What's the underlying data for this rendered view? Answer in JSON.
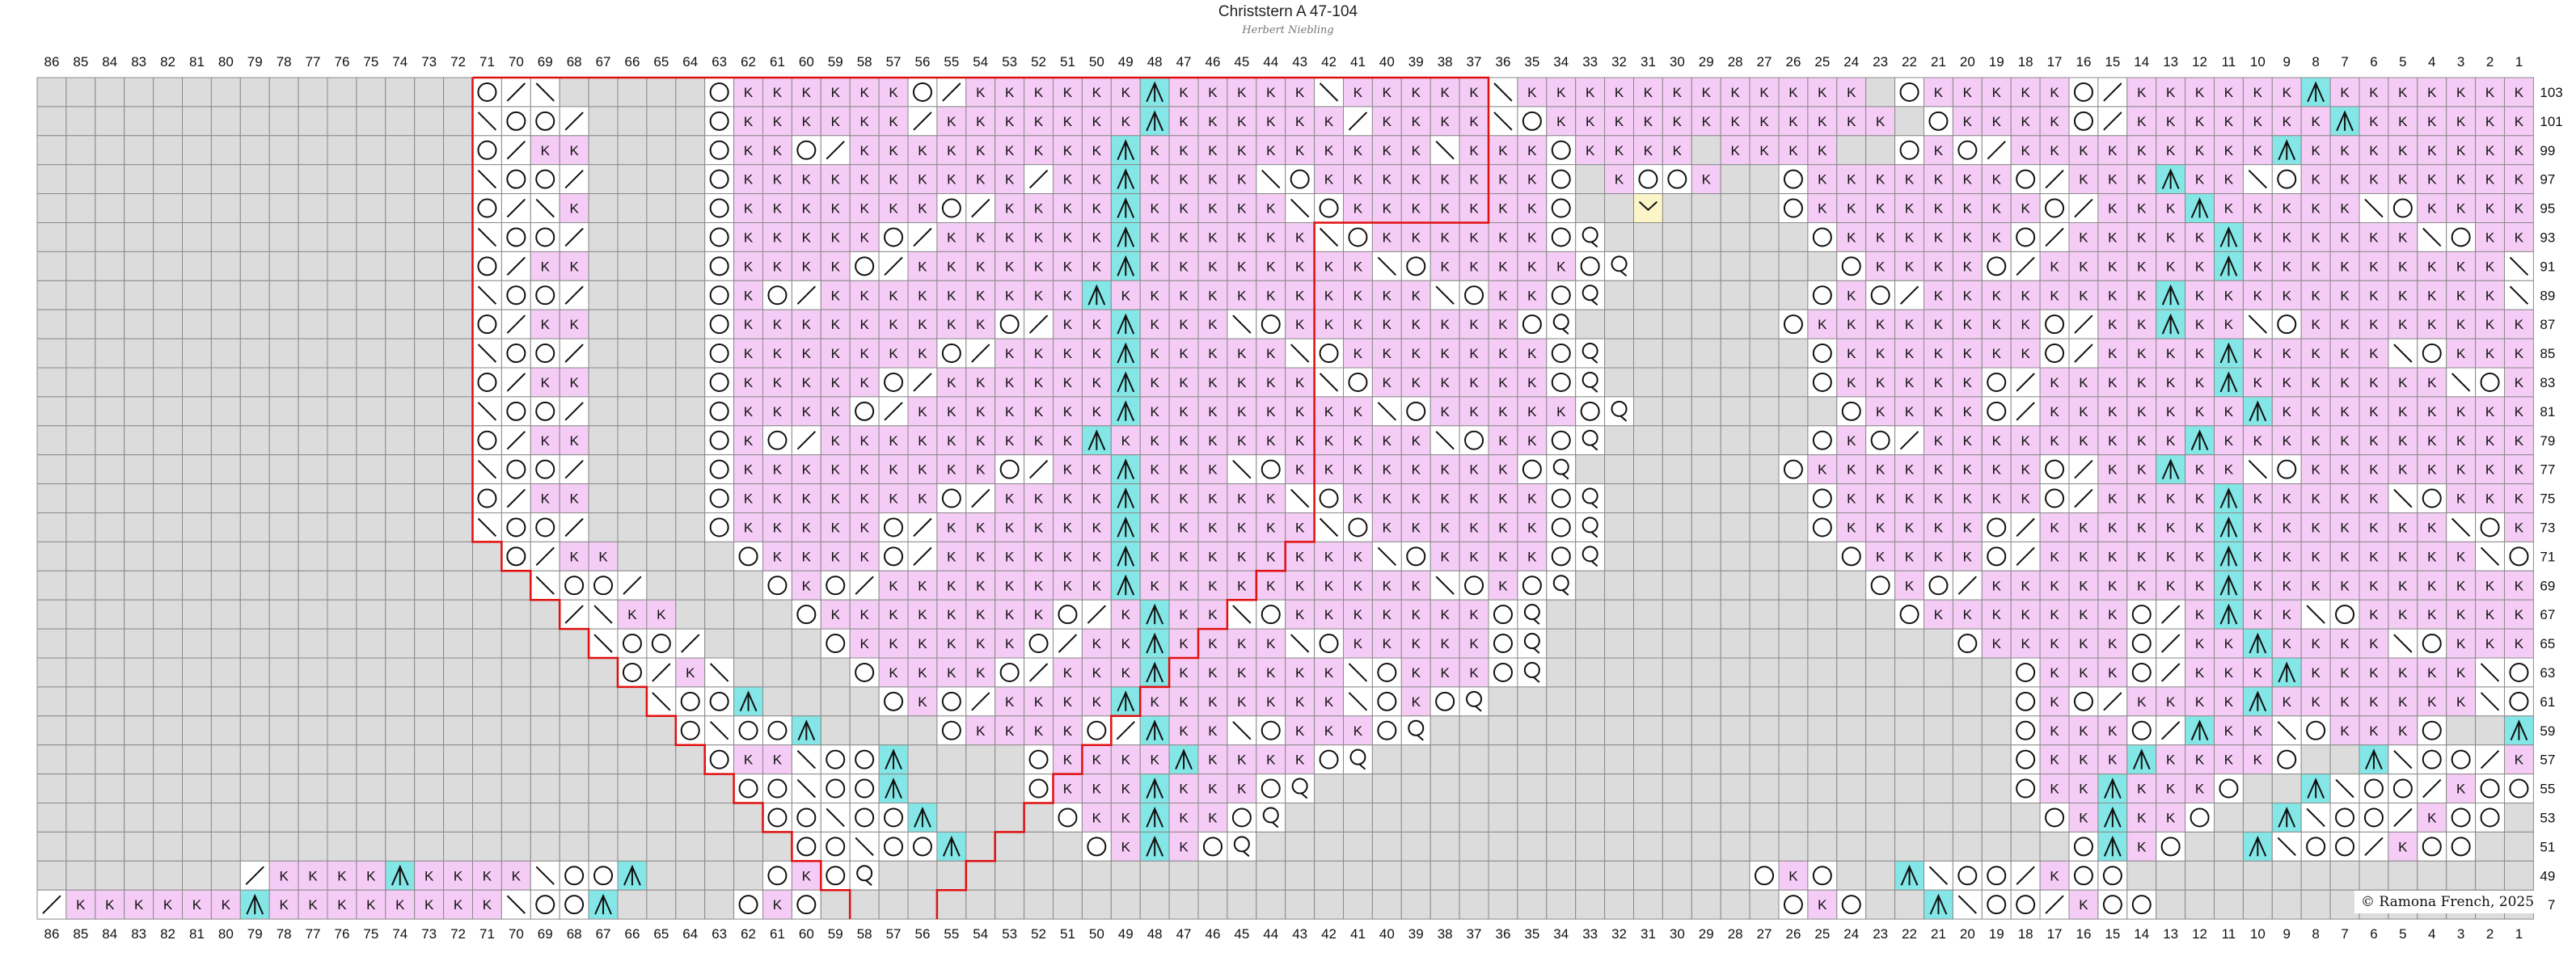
{
  "title": "Christstern A 47-104",
  "subtitle": "Herbert Niebling",
  "copyright": "©  Ramona French, 2025",
  "colors": {
    "background_cell": "#dcdcdc",
    "knit_cell": "#f5ccf5",
    "plain_cell": "#ffffff",
    "decrease_cell": "#84e6e6",
    "special_cell": "#fbf5c8",
    "outline": "#e01010",
    "grid_line": "#8a8a8a"
  },
  "column_numbers": [
    86,
    85,
    84,
    83,
    82,
    81,
    80,
    79,
    78,
    77,
    76,
    75,
    74,
    73,
    72,
    71,
    70,
    69,
    68,
    67,
    66,
    65,
    64,
    63,
    62,
    61,
    60,
    59,
    58,
    57,
    56,
    55,
    54,
    53,
    52,
    51,
    50,
    49,
    48,
    47,
    46,
    45,
    44,
    43,
    42,
    41,
    40,
    39,
    38,
    37,
    36,
    35,
    34,
    33,
    32,
    31,
    30,
    29,
    28,
    27,
    26,
    25,
    24,
    23,
    22,
    21,
    20,
    19,
    18,
    17,
    16,
    15,
    14,
    13,
    12,
    11,
    10,
    9,
    8,
    7,
    6,
    5,
    4,
    3,
    2,
    1
  ],
  "row_numbers": [
    103,
    101,
    99,
    97,
    95,
    93,
    91,
    89,
    87,
    85,
    83,
    81,
    79,
    77,
    75,
    73,
    71,
    69,
    67,
    65,
    63,
    61,
    59,
    57,
    55,
    53,
    51,
    49,
    47
  ],
  "legend": {
    "K": "knit (K)",
    "O": "yarn over",
    "/": "k2tog",
    "\\": "ssk",
    "A": "centered double decrease",
    "Q": "twisted yarn over",
    "V": "special stitch",
    "_": "no stitch",
    ".": "empty"
  },
  "chart_rows": [
    "_______________O/\\_____OKKKKKKO/KKKKKKAKKKKK\\KKKKK\\KKKKKKKKKKKK_OKKKKKO/KKKKKKAKKKKKKKK\\OKKKKO__/\\O_",
    "_______________\\OO/____OKKKKKK/KKKKKKKAKKKKKK/KKKK\\OKKKKKKKKKKKK_OKKKKO/KKKKKKKAKKKKKKKKK\\KKKKO__\\OO/_",
    "_______________O/KK____OKKO/KKKKKKKKKAKKKKKKKKKK\\KKKOKKKK_KKKK__OKO/KKKKKKKKKAKKKKKKKKKK\\OKO__KK\\O_",
    "_______________\\OO/____OKKKKKKKKKK/KKAKKKK\\OKKKKKKKKO_KOOK__OKKKKKKKO/KKKAKK\\OKKKKKKKKKO__\\OO/_",
    "_______________O/\\K____OKKKKKKKO/KKKKAKKKKK\\OKKKKKKKO__V____OKKKKKKKKO/KKKAKKKKK\\OKKKKKKKO__KK\\O_",
    "_______________\\OO/____OKKKKKO/KKKKKKAKKKKKK\\OKKKKKKOQ_______OKKKKKKO/KKKKKAKKKKKK\\OKKKKKKO__\\OO/_",
    "_______________O/KK____OKKKKO/KKKKKKKAKKKKKKKK\\OKKKKKOQ_______OKKKKO/KKKKKKAKKKKKKKKK\\OKKKKO__KK\\O_",
    "_______________\\OO/____OKO/KKKKKKKKKAKKKKKKKKKKK\\OKKOQ_______OKO/KKKKKKKKAKKKKKKKKKKK\\OKO__\\OO/_",
    "_______________O/KK____OKKKKKKKKKO/KKAKKK\\OKKKKKKKKOQ_______OKKKKKKKKO/KKAKK\\OKKKKKKKKKO__KK\\O_",
    "_______________\\OO/____OKKKKKKKO/KKKKAKKKKK\\OKKKKKKKOQ_______OKKKKKKKO/KKKKAKKKKK\\OKKKKKKKO__\\OO/_",
    "_______________O/KK____OKKKKKO/KKKKKKAKKKKKK\\OKKKKKKOQ_______OKKKKKO/KKKKKKAKKKKKKK\\OKKKKKKO__KK\\O_",
    "_______________\\OO/____OKKKKO/KKKKKKKAKKKKKKKK\\OKKKKKOQ_______OKKKKO/KKKKKKKAKKKKKKKKK\\OKKKKO__\\OO/_",
    "_______________O/KK____OKO/KKKKKKKKKAKKKKKKKKKKK\\OKKOQ_______OKO/KKKKKKKKKAKKKKKKKKKKK\\OKO__KK\\O_",
    "_______________\\OO/____OKKKKKKKKKO/KKAKKK\\OKKKKKKKKOQ_______OKKKKKKKKO/KKAKK\\OKKKKKKKKKO__\\OO/_",
    "_______________O/KK____OKKKKKKKO/KKKKAKKKKK\\OKKKKKKKOQ_______OKKKKKKKO/KKKKAKKKKK\\OKKKKKKKO__KK\\O_",
    "_______________\\OO/____OKKKKKO/KKKKKKAKKKKKK\\OKKKKKKOQ_______OKKKKKO/KKKKKKAKKKKKKK\\OKKKKKKO__\\OO/_",
    "________________O/KK____OKKKKO/KKKKKKAKKKKKKKK\\OKKKKOQ________OKKKKO/KKKKKKAKKKKKKKK\\OKKKKO__KK\\O__",
    "_________________\\OO/____OKO/KKKKKKKKAKKKKKKKKKK\\OKOQ__________OKO/KKKKKKKKAKKKKKKKKKK\\OKO__\\OO/___",
    "__________________/\\KK____OKKKKKKKKO/KAKK\\OKKKKKKKOQ____________OKKKKKKKO/KAKK\\OKKKKKKKO__KK\\O____",
    "___________________\\OO/____OKKKKKKO/KKAKKKK\\OKKKKKOQ______________OKKKKKO/KKAKKKK\\OKKKKKO__\\OO/_____",
    "____________________O/K\\____OKKKKO/KKKAKKKKKK\\OKKKOQ________________OKKKO/KKKAKKKKKK\\OKKKO__/KO______",
    "_____________________\\OOA____OKO/KKKKAKKKKKKK\\OKOQ__________________OKO/KKKKAKKKKKKK\\OKO__A\\OO/_____",
    "______________________O\\OOA____OKKKKO/AKK\\OKKKOQ____________________OKKKO/AKK\\OKKKO__A\\OO/KO____",
    "_______________________OKK\\OOA____OKKKKAKKKKOQ______________________OKKKAKKKKO__A\\OO/KO______",
    "________________________OO\\OOA____OKKKAKKKOQ________________________OKKAKKKO__A\\OO/KOO______",
    "_________________________OO\\OOA____OKKAKKOQ__________________________OKAKKO__A\\OO/KOO_______",
    "__________________________OO\\OOA____OKAKOQ____________________________OAKO__A\\OO/KOO________",
    "_______/KKKKAKKKK\\OOA____OKOQ______________________________OKO__A\\OO/KOO______________________",
    "/KKKKKKAKKKKKKKK\\OOA____OKO_________________________________OKO__A\\OO/KOO_________________________"
  ]
}
